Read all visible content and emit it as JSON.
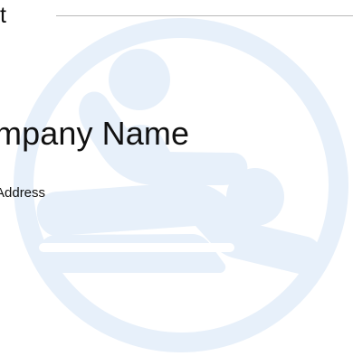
{
  "header": {
    "title_fragment": "t"
  },
  "company": {
    "name_fragment": "mpany Name",
    "address_fragment": "Address"
  },
  "watermark": {
    "icon": "massage-therapy-icon",
    "color": "#e7f0fa"
  }
}
